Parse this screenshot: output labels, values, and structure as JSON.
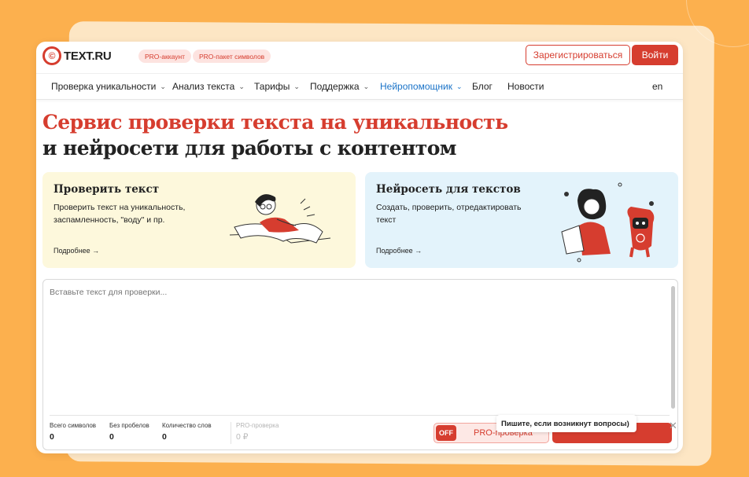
{
  "header": {
    "logo_text": "TEXT.RU",
    "logo_mark": "©",
    "pills": [
      "PRO-аккаунт",
      "PRO-пакет символов"
    ],
    "register_label": "Зарегистрироваться",
    "login_label": "Войти"
  },
  "nav": {
    "items": [
      {
        "label": "Проверка уникальности",
        "dropdown": true
      },
      {
        "label": "Анализ текста",
        "dropdown": true
      },
      {
        "label": "Тарифы",
        "dropdown": true
      },
      {
        "label": "Поддержка",
        "dropdown": true
      },
      {
        "label": "Нейропомощник",
        "dropdown": true,
        "active": true
      },
      {
        "label": "Блог",
        "dropdown": false
      },
      {
        "label": "Новости",
        "dropdown": false
      }
    ],
    "lang": "en",
    "chevron": "⌄"
  },
  "hero": {
    "line1": "Сервис проверки текста на уникальность",
    "line2": "и нейросети для работы с контентом"
  },
  "cards": [
    {
      "title": "Проверить текст",
      "description": "Проверить текст на уникальность, заспамленность, \"воду\" и пр.",
      "link": "Подробнее →",
      "illustration": "reading-person-icon"
    },
    {
      "title": "Нейросеть для текстов",
      "description": "Создать, проверить, отредактировать текст",
      "link": "Подробнее →",
      "illustration": "person-and-robot-icon"
    }
  ],
  "editor": {
    "placeholder": "Вставьте текст для проверки...",
    "value": ""
  },
  "stats": {
    "total_label": "Всего символов",
    "total_value": "0",
    "nospace_label": "Без пробелов",
    "nospace_value": "0",
    "words_label": "Количество слов",
    "words_value": "0",
    "pro_label": "PRO-проверка",
    "pro_value": "0 ₽"
  },
  "pro_toggle": {
    "state": "OFF",
    "label": "PRO-проверка"
  },
  "chat": {
    "tip": "Пишите, если возникнут вопросы)",
    "close": "✕"
  },
  "colors": {
    "accent": "#d63d2f",
    "active_nav": "#1a73c8",
    "background": "#fcb04e",
    "card_yellow": "#fdf8dc",
    "card_blue": "#e3f3fb"
  }
}
